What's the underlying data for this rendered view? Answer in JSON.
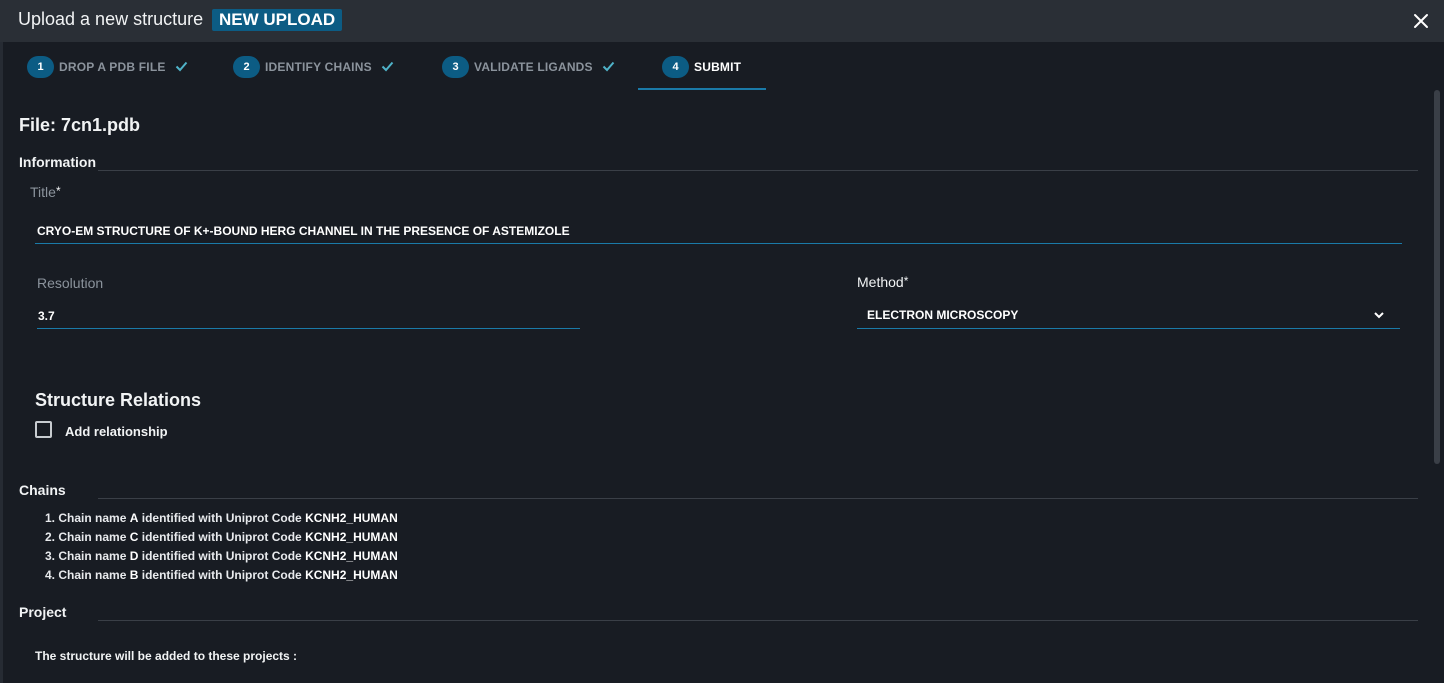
{
  "header": {
    "title": "Upload a new structure",
    "badge": "NEW UPLOAD",
    "close_icon": "close-icon"
  },
  "steps": [
    {
      "number": "1",
      "label": "DROP A PDB FILE",
      "completed": true
    },
    {
      "number": "2",
      "label": "IDENTIFY CHAINS",
      "completed": true
    },
    {
      "number": "3",
      "label": "VALIDATE LIGANDS",
      "completed": true
    },
    {
      "number": "4",
      "label": "SUBMIT",
      "completed": false,
      "active": true
    }
  ],
  "file": {
    "title": "File: 7cn1.pdb"
  },
  "information": {
    "heading": "Information",
    "title_label": "Title",
    "title_value": "CRYO-EM STRUCTURE OF K+-BOUND HERG CHANNEL IN THE PRESENCE OF ASTEMIZOLE",
    "resolution_label": "Resolution",
    "resolution_value": "3.7",
    "method_label": "Method",
    "method_value": "ELECTRON MICROSCOPY",
    "required_marker": "*"
  },
  "relations": {
    "heading": "Structure Relations",
    "checkbox_label": "Add relationship",
    "checked": false
  },
  "chains": {
    "heading": "Chains",
    "prefix": "Chain name",
    "middle": "identified with Uniprot Code",
    "items": [
      {
        "index": "1.",
        "name": "A",
        "code": "KCNH2_HUMAN"
      },
      {
        "index": "2.",
        "name": "C",
        "code": "KCNH2_HUMAN"
      },
      {
        "index": "3.",
        "name": "D",
        "code": "KCNH2_HUMAN"
      },
      {
        "index": "4.",
        "name": "B",
        "code": "KCNH2_HUMAN"
      }
    ]
  },
  "project": {
    "heading": "Project",
    "text": "The structure will be added to these projects :"
  },
  "colors": {
    "accent": "#0c5c84",
    "underline": "#1a7aa8",
    "check": "#4fb3c9",
    "background": "#181c23",
    "header_bg": "#2a2f36"
  }
}
